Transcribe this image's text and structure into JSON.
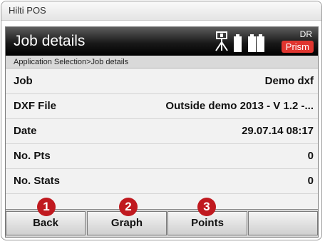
{
  "window": {
    "app_title": "Hilti POS"
  },
  "header": {
    "title": "Job details",
    "dr_label": "DR",
    "prism_label": "Prism",
    "status_accent": "#e0352f"
  },
  "breadcrumb": "Application Selection>Job details",
  "rows": [
    {
      "label": "Job",
      "value": "Demo dxf"
    },
    {
      "label": "DXF File",
      "value": "Outside demo 2013 - V 1.2 -..."
    },
    {
      "label": "Date",
      "value": "29.07.14 08:17"
    },
    {
      "label": "No. Pts",
      "value": "0"
    },
    {
      "label": "No. Stats",
      "value": "0"
    }
  ],
  "softkeys": [
    {
      "label": "Back",
      "marker": "1"
    },
    {
      "label": "Graph",
      "marker": "2"
    },
    {
      "label": "Points",
      "marker": "3"
    },
    {
      "label": "",
      "marker": ""
    }
  ],
  "badge_color": "#c0191f"
}
